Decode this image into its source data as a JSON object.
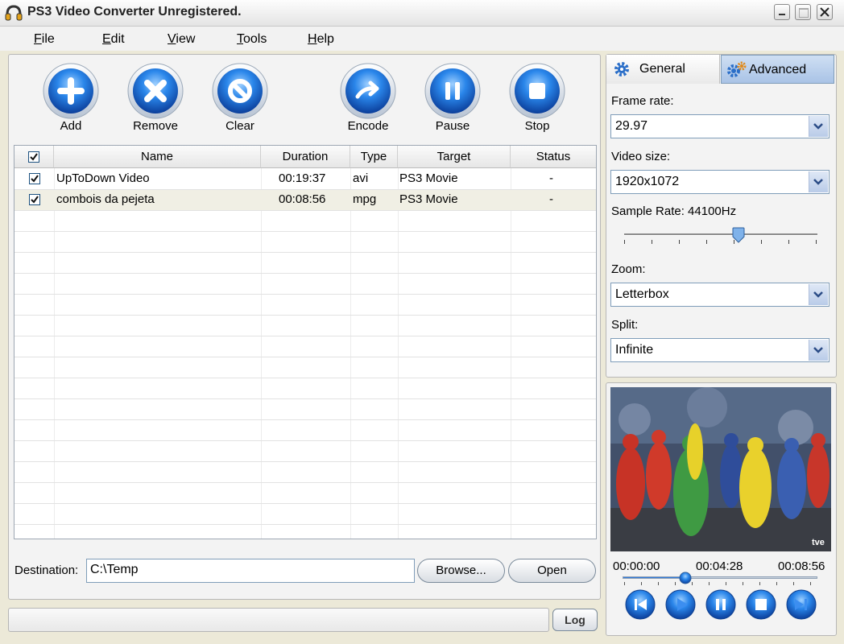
{
  "window": {
    "title": "PS3 Video Converter Unregistered."
  },
  "menu": [
    {
      "label": "File",
      "key": "F",
      "rest": "ile"
    },
    {
      "label": "Edit",
      "key": "E",
      "rest": "dit"
    },
    {
      "label": "View",
      "key": "V",
      "rest": "iew"
    },
    {
      "label": "Tools",
      "key": "T",
      "rest": "ools"
    },
    {
      "label": "Help",
      "key": "H",
      "rest": "elp"
    }
  ],
  "toolbar": {
    "add": "Add",
    "remove": "Remove",
    "clear": "Clear",
    "encode": "Encode",
    "pause": "Pause",
    "stop": "Stop"
  },
  "table": {
    "columns": [
      "Name",
      "Duration",
      "Type",
      "Target",
      "Status"
    ],
    "rows": [
      {
        "name": "UpToDown Video",
        "duration": "00:19:37",
        "type": "avi",
        "target": "PS3 Movie",
        "status": "-"
      },
      {
        "name": "combois da pejeta",
        "duration": "00:08:56",
        "type": "mpg",
        "target": "PS3 Movie",
        "status": "-"
      }
    ]
  },
  "destination": {
    "label": "Destination:",
    "value": "C:\\Temp",
    "browse": "Browse...",
    "open": "Open"
  },
  "log": "Log",
  "tabs": {
    "general": "General",
    "advanced": "Advanced"
  },
  "settings": {
    "frame_rate_label": "Frame rate:",
    "frame_rate": "29.97",
    "video_size_label": "Video size:",
    "video_size": "1920x1072",
    "sample_rate_label": "Sample Rate: 44100Hz",
    "sample_rate_fraction": 0.59,
    "zoom_label": "Zoom:",
    "zoom": "Letterbox",
    "split_label": "Split:",
    "split": "Infinite"
  },
  "player": {
    "time_start": "00:00:00",
    "time_current": "00:04:28",
    "time_end": "00:08:56",
    "progress_fraction": 0.3,
    "watermark": "tve"
  },
  "colors": {
    "accent": "#1a6fd6",
    "selected_row": "#f0efe4",
    "video_bg": "#2b3a55"
  }
}
